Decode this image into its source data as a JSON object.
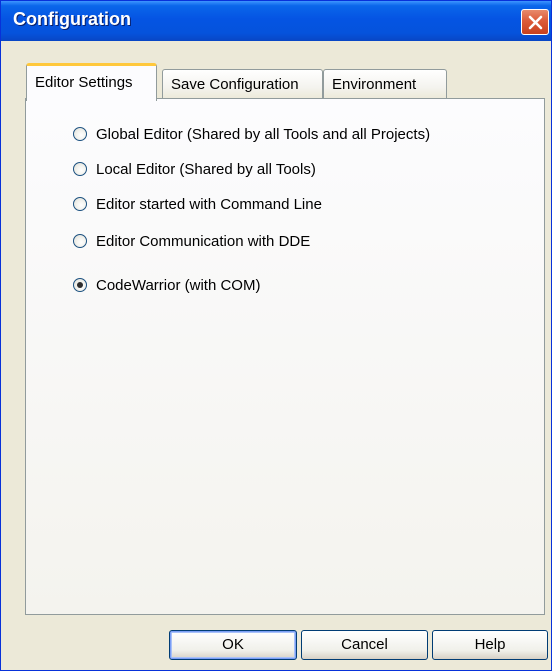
{
  "window": {
    "title": "Configuration"
  },
  "tabs": [
    {
      "label": "Editor Settings",
      "active": true
    },
    {
      "label": "Save Configuration",
      "active": false
    },
    {
      "label": "Environment",
      "active": false
    }
  ],
  "editor_options": [
    {
      "label": "Global Editor (Shared by all Tools and all Projects)",
      "checked": false
    },
    {
      "label": "Local Editor (Shared by all Tools)",
      "checked": false
    },
    {
      "label": "Editor started with Command Line",
      "checked": false
    },
    {
      "label": "Editor Communication with DDE",
      "checked": false
    },
    {
      "label": "CodeWarrior (with COM)",
      "checked": true
    }
  ],
  "buttons": {
    "ok": "OK",
    "cancel": "Cancel",
    "help": "Help"
  },
  "colors": {
    "titlebar": "#0554e3",
    "dialog_bg": "#ece9d8",
    "active_tab_highlight": "#ffc83c",
    "close_button": "#dc5b3a"
  },
  "icons": {
    "close": "close-icon"
  }
}
